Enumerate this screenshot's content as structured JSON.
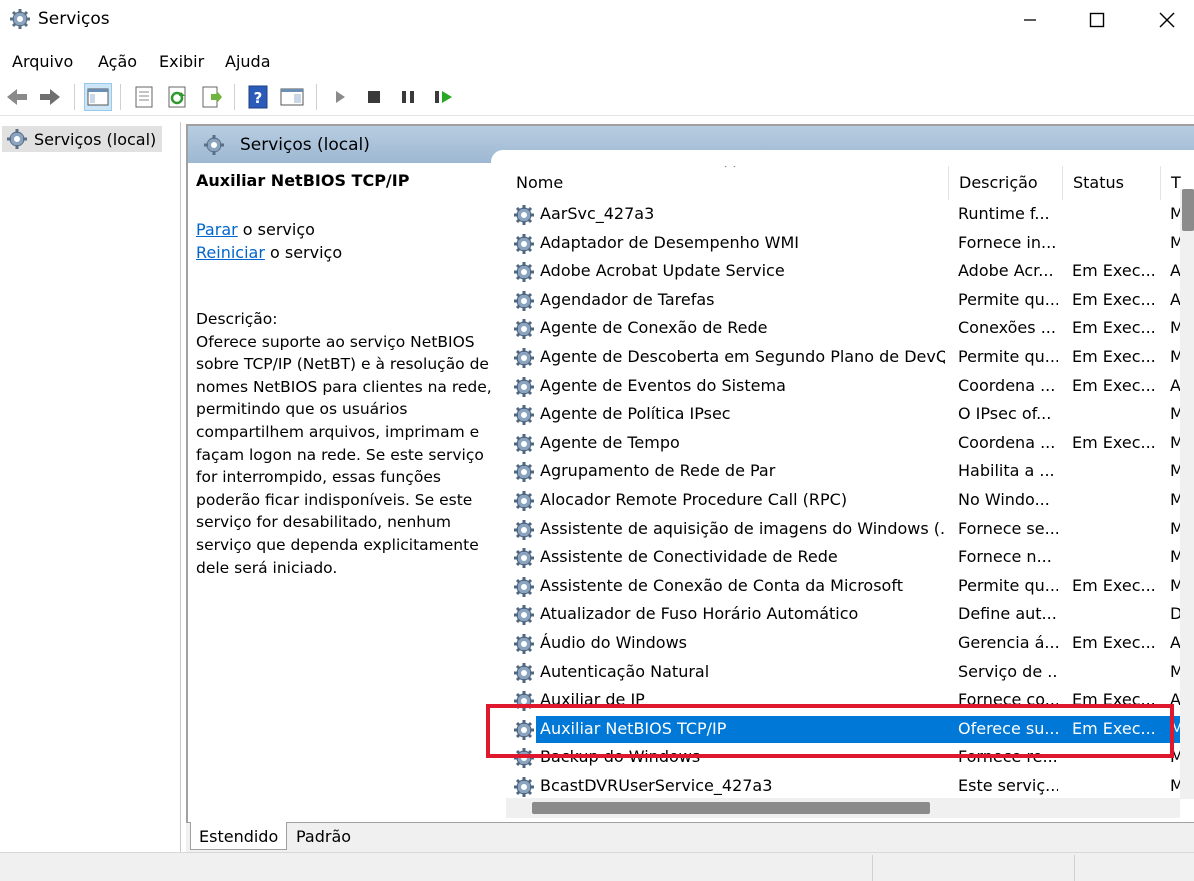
{
  "window": {
    "title": "Serviços"
  },
  "menu": [
    "Arquivo",
    "Ação",
    "Exibir",
    "Ajuda"
  ],
  "tree": {
    "root": "Serviços (local)"
  },
  "panel": {
    "title": "Serviços (local)"
  },
  "details": {
    "service_name": "Auxiliar NetBIOS TCP/IP",
    "stop_link": "Parar",
    "stop_suffix": " o serviço",
    "restart_link": "Reiniciar",
    "restart_suffix": " o serviço",
    "description_label": "Descrição:",
    "description": "Oferece suporte ao serviço NetBIOS sobre TCP/IP (NetBT) e à resolução de nomes NetBIOS para clientes na rede, permitindo que os usuários compartilhem arquivos, imprimam e façam logon na rede. Se este serviço for interrompido, essas funções poderão ficar indisponíveis. Se este serviço for desabilitado, nenhum serviço que dependa explicitamente dele será iniciado."
  },
  "columns": {
    "name": "Nome",
    "description": "Descrição",
    "status": "Status",
    "type": "T"
  },
  "services": [
    {
      "name": "AarSvc_427a3",
      "desc": "Runtime f...",
      "status": "",
      "type": "M"
    },
    {
      "name": "Adaptador de Desempenho WMI",
      "desc": "Fornece in...",
      "status": "",
      "type": "M"
    },
    {
      "name": "Adobe Acrobat Update Service",
      "desc": "Adobe Acr...",
      "status": "Em Exec...",
      "type": "A"
    },
    {
      "name": "Agendador de Tarefas",
      "desc": "Permite qu...",
      "status": "Em Exec...",
      "type": "A"
    },
    {
      "name": "Agente de Conexão de Rede",
      "desc": "Conexões ...",
      "status": "Em Exec...",
      "type": "M"
    },
    {
      "name": "Agente de Descoberta em Segundo Plano de DevQ...",
      "desc": "Permite qu...",
      "status": "Em Exec...",
      "type": "M"
    },
    {
      "name": "Agente de Eventos do Sistema",
      "desc": "Coordena ...",
      "status": "Em Exec...",
      "type": "A"
    },
    {
      "name": "Agente de Política IPsec",
      "desc": "O IPsec of...",
      "status": "",
      "type": "M"
    },
    {
      "name": "Agente de Tempo",
      "desc": "Coordena ...",
      "status": "Em Exec...",
      "type": "M"
    },
    {
      "name": "Agrupamento de Rede de Par",
      "desc": "Habilita a ...",
      "status": "",
      "type": "M"
    },
    {
      "name": "Alocador Remote Procedure Call (RPC)",
      "desc": "No Windo...",
      "status": "",
      "type": "M"
    },
    {
      "name": "Assistente de aquisição de imagens do Windows (...",
      "desc": "Fornece se...",
      "status": "",
      "type": "M"
    },
    {
      "name": "Assistente de Conectividade de Rede",
      "desc": "Fornece n...",
      "status": "",
      "type": "M"
    },
    {
      "name": "Assistente de Conexão de Conta da Microsoft",
      "desc": "Permite qu...",
      "status": "Em Exec...",
      "type": "M"
    },
    {
      "name": "Atualizador de Fuso Horário Automático",
      "desc": "Define aut...",
      "status": "",
      "type": "D"
    },
    {
      "name": "Áudio do Windows",
      "desc": "Gerencia á...",
      "status": "Em Exec...",
      "type": "A"
    },
    {
      "name": "Autenticação Natural",
      "desc": "Serviço de ...",
      "status": "",
      "type": "M"
    },
    {
      "name": "Auxiliar de IP",
      "desc": "Fornece co...",
      "status": "Em Exec...",
      "type": "A"
    },
    {
      "name": "Auxiliar NetBIOS TCP/IP",
      "desc": "Oferece su...",
      "status": "Em Exec...",
      "type": "M"
    },
    {
      "name": "Backup do Windows",
      "desc": "Fornece re...",
      "status": "",
      "type": "M"
    },
    {
      "name": "BcastDVRUserService_427a3",
      "desc": "Este serviç...",
      "status": "",
      "type": "M"
    }
  ],
  "selected_index": 18,
  "tabs": [
    "Estendido",
    "Padrão"
  ],
  "colors": {
    "selection": "#0078d7",
    "highlight": "#e0182d",
    "link": "#0066cc",
    "header": "#9db8d2"
  }
}
